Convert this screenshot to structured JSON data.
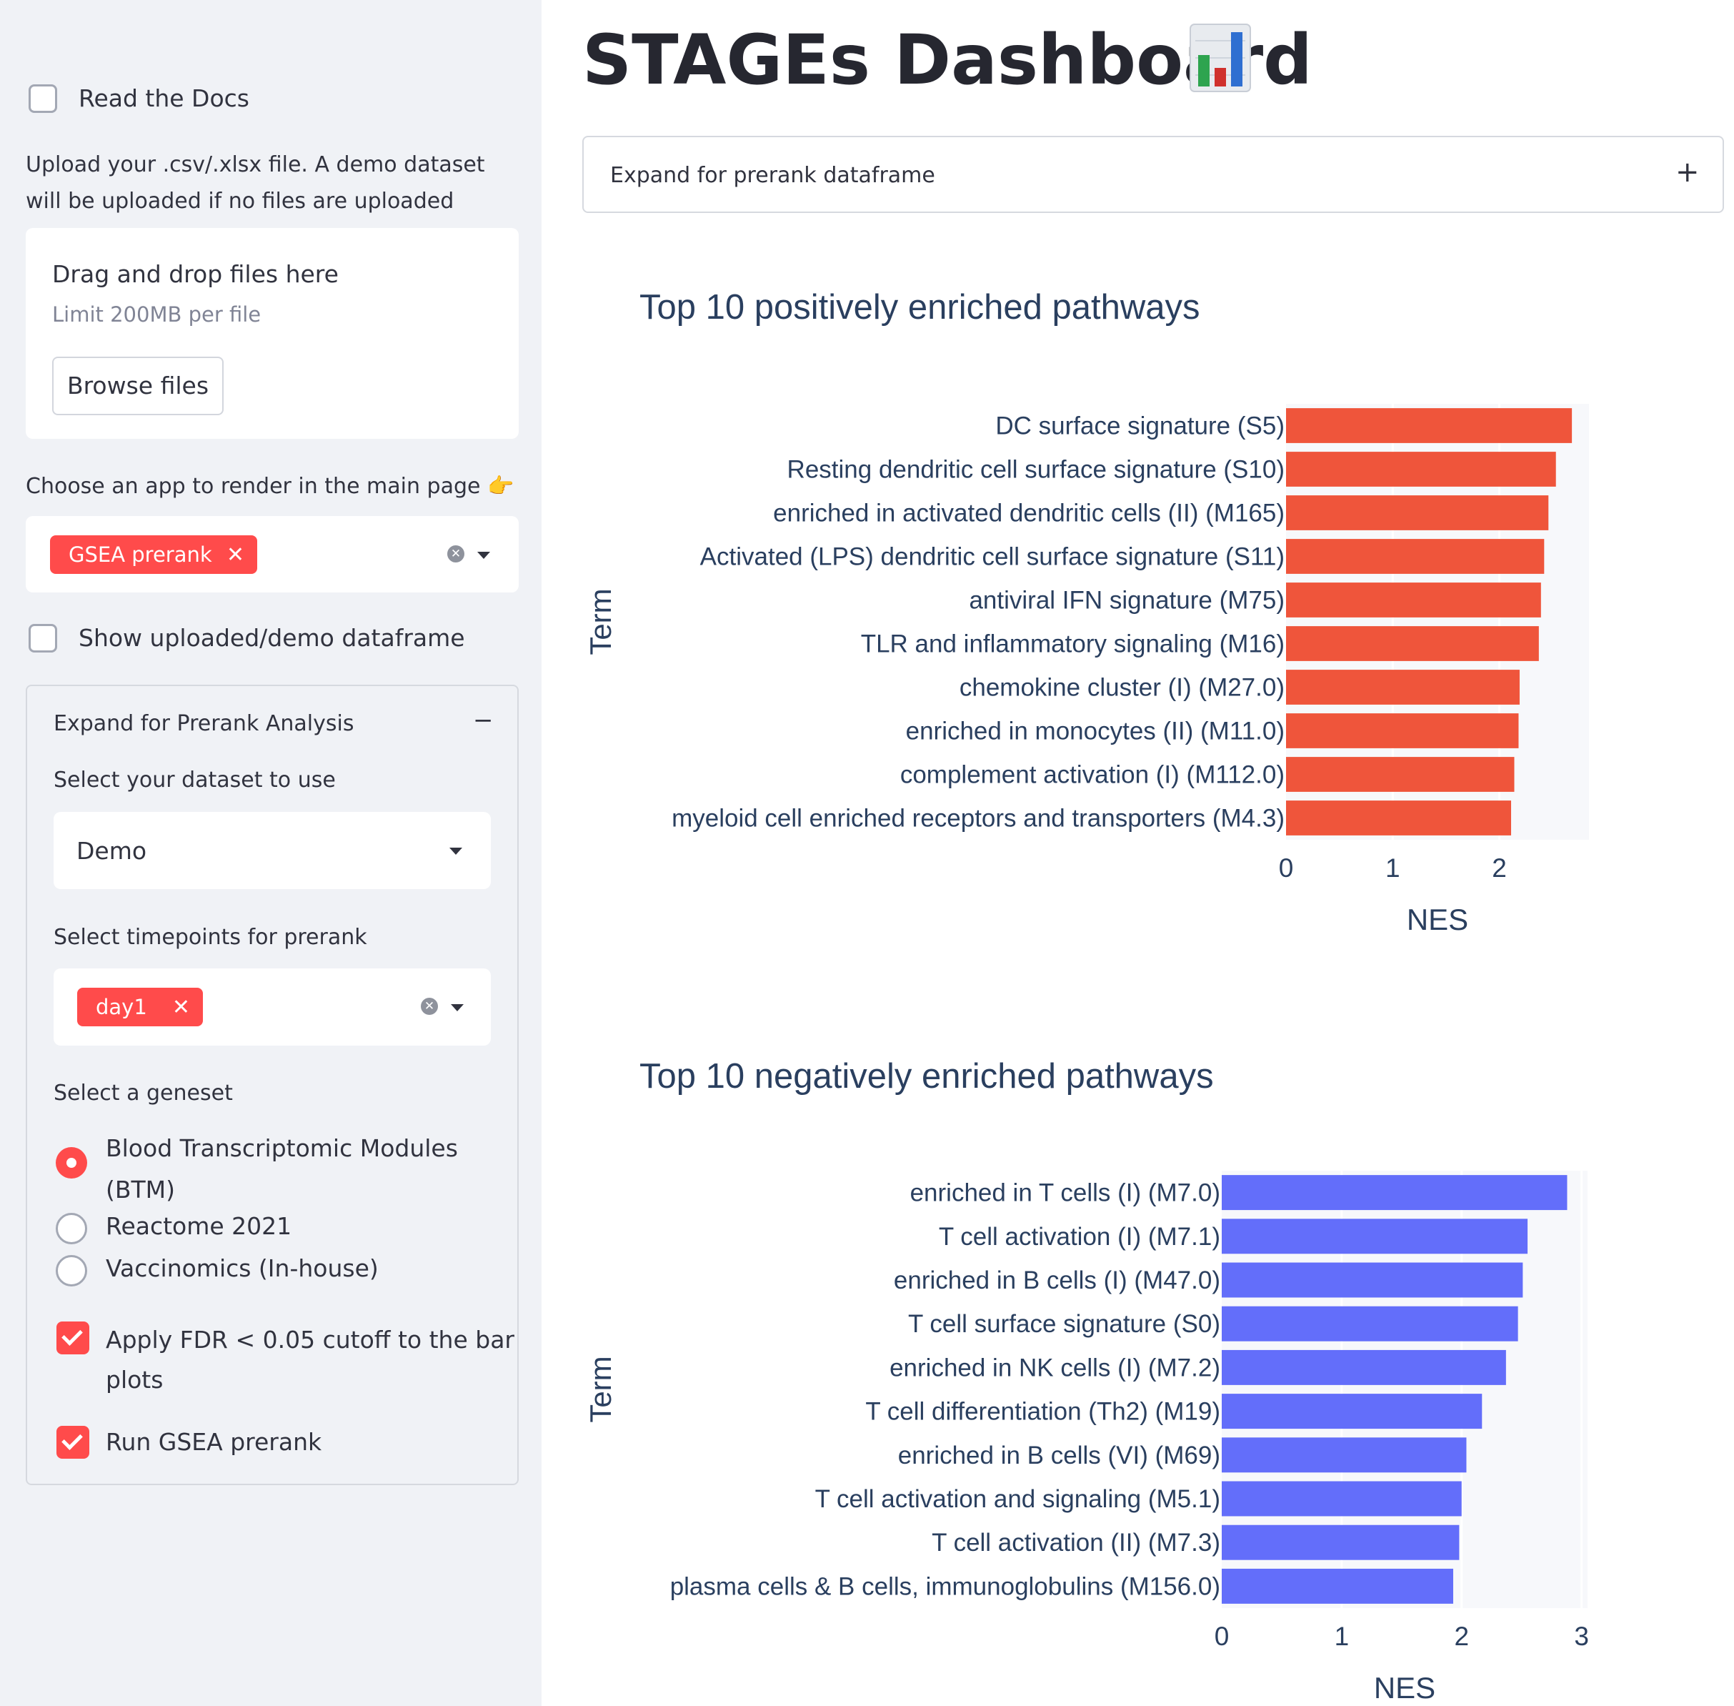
{
  "sidebar": {
    "read_docs_label": "Read the Docs",
    "upload_desc": "Upload your .csv/.xlsx file. A demo dataset will be uploaded if no files are uploaded",
    "dropzone": {
      "title": "Drag and drop files here",
      "limit": "Limit 200MB per file",
      "browse_label": "Browse files"
    },
    "choose_app_label": "Choose an app to render in the main page 👉",
    "app_select": {
      "selected_tag": "GSEA prerank"
    },
    "show_df_label": "Show uploaded/demo dataframe",
    "prerank_expander": {
      "header": "Expand for Prerank Analysis",
      "collapse_symbol": "−",
      "dataset_label": "Select your dataset to use",
      "dataset_value": "Demo",
      "timepoints_label": "Select timepoints for prerank",
      "timepoint_tag": "day1",
      "geneset_label": "Select a geneset",
      "geneset_options": [
        {
          "label_line1": "Blood Transcriptomic Modules",
          "label_line2": "(BTM)",
          "selected": true
        },
        {
          "label_line1": "Reactome 2021",
          "selected": false
        },
        {
          "label_line1": "Vaccinomics (In-house)",
          "selected": false
        }
      ],
      "fdr_label_line1": "Apply FDR < 0.05 cutoff to the bar",
      "fdr_label_line2": "plots",
      "fdr_checked": true,
      "run_label": "Run GSEA prerank",
      "run_checked": true
    }
  },
  "main": {
    "title": "STAGEs Dashboard",
    "title_icon": "bar-chart-icon",
    "expander_label": "Expand for prerank dataframe",
    "expander_symbol": "+"
  },
  "chart_data": [
    {
      "type": "bar",
      "orientation": "horizontal",
      "title": "Top 10 positively enriched pathways",
      "xlabel": "NES",
      "ylabel": "Term",
      "xlim": [
        0,
        2.84
      ],
      "xticks": [
        0,
        1,
        2
      ],
      "color": "#ef553b",
      "categories": [
        "DC surface signature (S5)",
        "Resting dendritic cell surface signature (S10)",
        "enriched in activated dendritic cells (II) (M165)",
        "Activated (LPS) dendritic cell surface signature (S11)",
        "antiviral IFN signature (M75)",
        "TLR and inflammatory signaling (M16)",
        "chemokine cluster (I) (M27.0)",
        "enriched in monocytes (II) (M11.0)",
        "complement activation (I) (M112.0)",
        "myeloid cell enriched receptors and transporters (M4.3)"
      ],
      "values": [
        2.68,
        2.53,
        2.46,
        2.42,
        2.39,
        2.37,
        2.19,
        2.18,
        2.14,
        2.11
      ]
    },
    {
      "type": "bar",
      "orientation": "horizontal",
      "title": "Top 10 negatively enriched pathways",
      "xlabel": "NES",
      "ylabel": "Term",
      "xlim": [
        0,
        3.05
      ],
      "xticks": [
        0,
        1,
        2,
        3
      ],
      "color": "#636efa",
      "categories": [
        "enriched in T cells (I) (M7.0)",
        "T cell activation (I) (M7.1)",
        "enriched in B cells (I) (M47.0)",
        "T cell surface signature (S0)",
        "enriched in NK cells (I) (M7.2)",
        "T cell differentiation (Th2) (M19)",
        "enriched in B cells (VI) (M69)",
        "T cell activation and signaling (M5.1)",
        "T cell activation (II) (M7.3)",
        "plasma cells & B cells, immunoglobulins (M156.0)"
      ],
      "values": [
        2.88,
        2.55,
        2.51,
        2.47,
        2.37,
        2.17,
        2.04,
        2.0,
        1.98,
        1.93
      ]
    }
  ]
}
